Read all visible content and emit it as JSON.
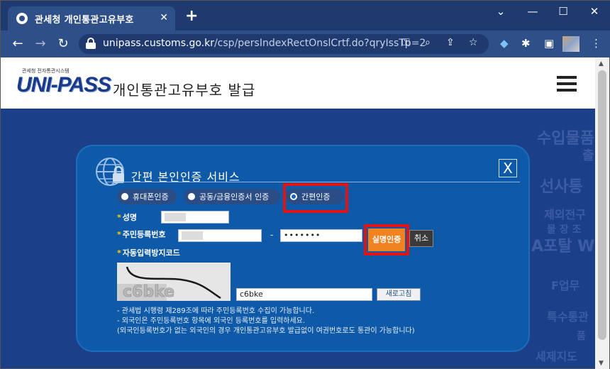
{
  "browser": {
    "tab_title": "관세청 개인통관고유부호",
    "url_host": "unipass.customs.go.kr",
    "url_path": "/csp/persIndexRectOnslCrtf.do?qryIssTp=2"
  },
  "site": {
    "logo_small": "관세청 전자통관시스템",
    "logo_main": "UNI-PASS",
    "title": "개인통관고유부호 발급"
  },
  "background": {
    "words": [
      "수입물품",
      "출",
      "선사통",
      "제외전구",
      "물 장 조",
      "A포탈 W",
      "F업무",
      "특수통관",
      "품",
      "세제지도"
    ]
  },
  "modal": {
    "title": "간편 본인인증 서비스",
    "close": "X",
    "radios": [
      {
        "label": "휴대폰인증",
        "checked": false
      },
      {
        "label": "공동/금융인증서 인증",
        "checked": false
      },
      {
        "label": "간편인증",
        "checked": true
      }
    ],
    "name_label": "성명",
    "rrn_label": "주민등록번호",
    "rrn_separator": "-",
    "rrn_back_value": "•••••••",
    "verify_button": "실명인증",
    "cancel_button": "취소",
    "captcha_label": "자동입력방지코드",
    "captcha_value": "c6bke",
    "refresh_button": "새로고침",
    "notes": [
      "- 관세법 시행령 제289조에 따라 주민등록번호 수집이 가능합니다.",
      "- 외국인은 주민등록번호 항목에 외국인 등록번호를 입력하세요.",
      "(외국인등록번호가 없는 외국인의 경우 개인통관고유부호 발급없이 여권번호로도 통관이 가능합니다)"
    ]
  }
}
